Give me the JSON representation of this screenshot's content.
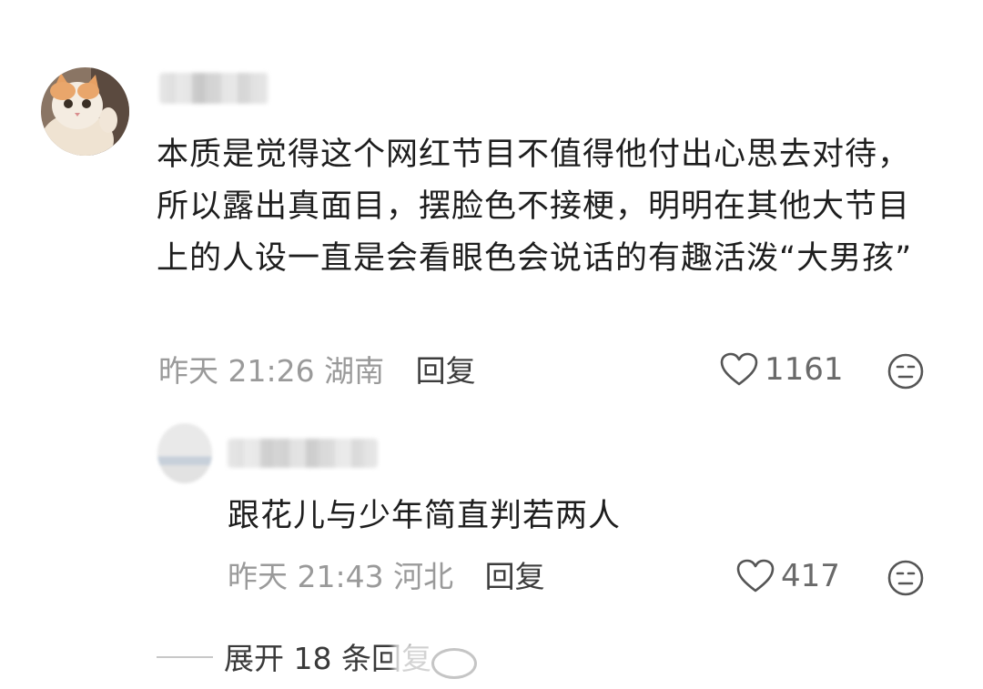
{
  "comment": {
    "text": "本质是觉得这个网红节目不值得他付出心思去对待，所以露出真面目，摆脸色不接梗，明明在其他大节目上的人设一直是会看眼色会说话的有趣活泼“大男孩”",
    "time": "昨天 21:26",
    "location": "湖南",
    "reply_label": "回复",
    "likes": "1161",
    "avatar_icon": "cat-avatar",
    "dislike_icon": "neutral-face-icon"
  },
  "reply": {
    "text": "跟花儿与少年简直判若两人",
    "time": "昨天 21:43",
    "location": "河北",
    "reply_label": "回复",
    "likes": "417"
  },
  "expand": {
    "label": "展开 18 条回复"
  }
}
